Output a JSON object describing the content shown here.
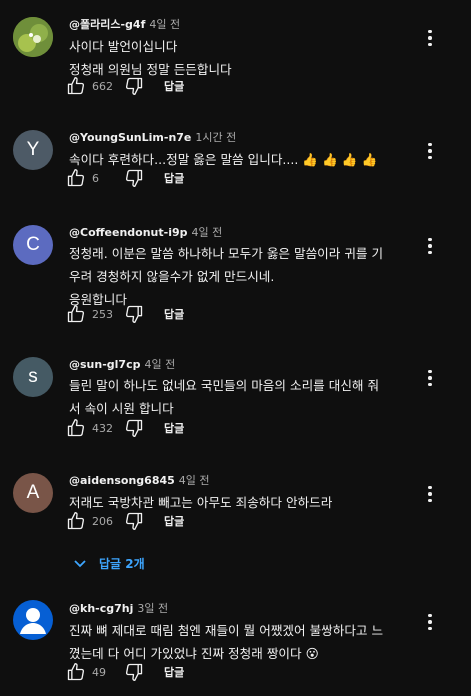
{
  "reply_label": "답글",
  "comments": [
    {
      "handle": "@폴라리스-g4f",
      "time": "4일 전",
      "text": "사이다 발언이십니다\n정청래 의원님 정말 든든합니다",
      "likes": "662",
      "avatar": {
        "type": "image",
        "color": "#7a9a3a"
      }
    },
    {
      "handle": "@YoungSunLim-n7e",
      "time": "1시간 전",
      "text": "속이다 후련하다...정말 옳은 말씀 입니다.... 👍 👍 👍 👍",
      "likes": "6",
      "avatar": {
        "type": "letter",
        "letter": "Y",
        "color": "#4d5a66"
      }
    },
    {
      "handle": "@Coffeendonut-i9p",
      "time": "4일 전",
      "text": "정청래. 이분은 말씀 하나하나 모두가 옳은 말씀이라 귀를 기\n우려 경청하지 않을수가 없게 만드시네.\n응원합니다",
      "likes": "253",
      "avatar": {
        "type": "letter",
        "letter": "C",
        "color": "#5c6bc0"
      }
    },
    {
      "handle": "@sun-gl7cp",
      "time": "4일 전",
      "text": "들린 말이 하나도 없네요 국민들의 마음의 소리를 대신해 줘\n서 속이 시원 합니다",
      "likes": "432",
      "avatar": {
        "type": "letter",
        "letter": "s",
        "color": "#455a64"
      }
    },
    {
      "handle": "@aidensong6845",
      "time": "4일 전",
      "text": "저래도 국방차관 빼고는 아무도 죄송하다 안하드라",
      "likes": "206",
      "avatar": {
        "type": "letter",
        "letter": "A",
        "color": "#795548"
      }
    },
    {
      "handle": "@kh-cg7hj",
      "time": "3일 전",
      "text": "진짜 뼈 제대로 때림 첨엔 재들이 뭘 어쨌겠어 불쌍하다고 느\n꼈는데 다 어디 가있었냐 진짜 정청래 짱이다 😮",
      "likes": "49",
      "avatar": {
        "type": "default",
        "color": "#065fd4"
      }
    }
  ],
  "replies_toggle": {
    "label": "답글 2개"
  },
  "colors": {
    "background": "#0f0f0f",
    "text": "#f1f1f1",
    "secondary": "#aaaaaa",
    "link": "#3ea6ff"
  }
}
